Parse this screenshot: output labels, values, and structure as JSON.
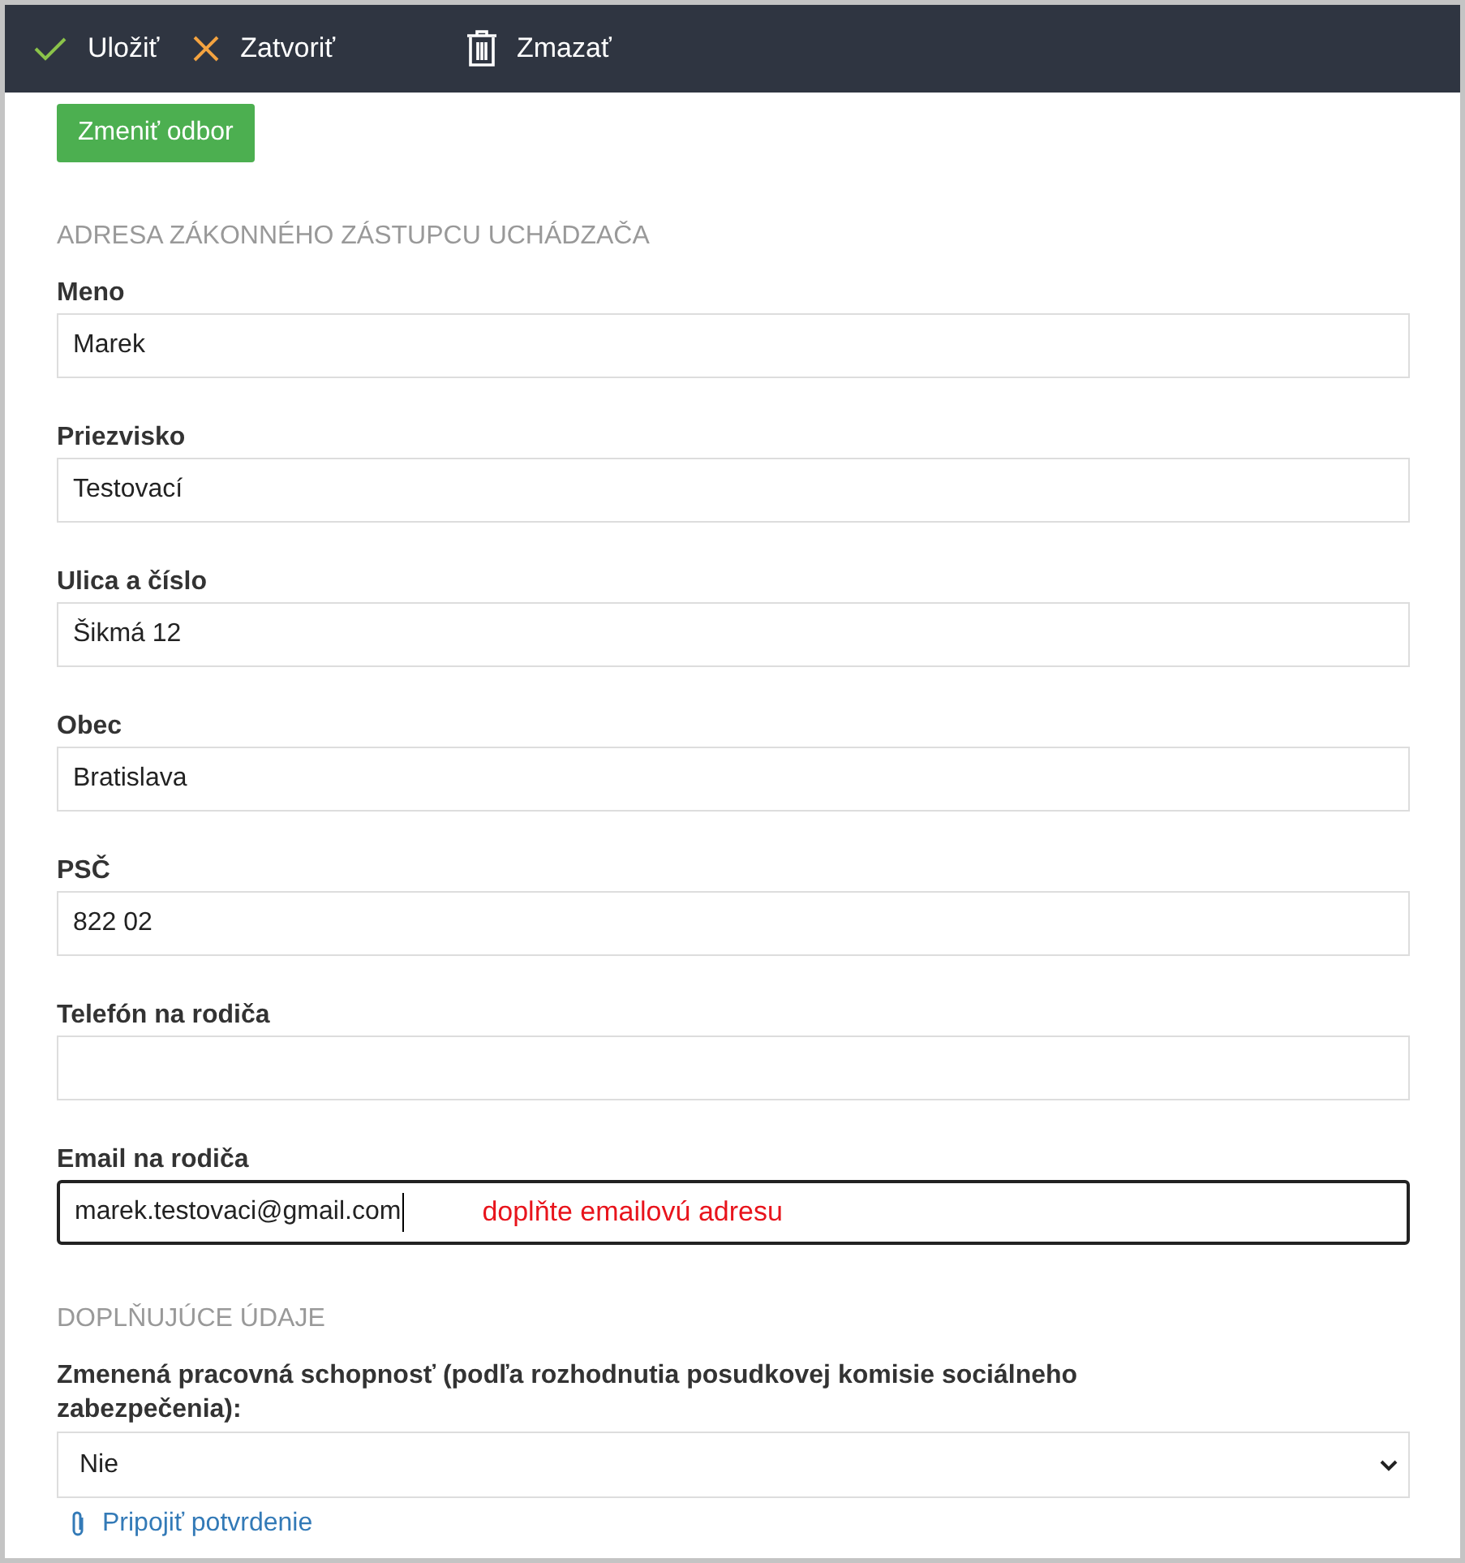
{
  "toolbar": {
    "buttons": [
      {
        "kind": "save",
        "label": "Uložiť"
      },
      {
        "kind": "close",
        "label": "Zatvoriť"
      },
      {
        "kind": "delete",
        "label": "Zmazať"
      }
    ]
  },
  "change_button": {
    "label": "Zmeniť odbor"
  },
  "sections": [
    {
      "heading": "ADRESA ZÁKONNÉHO ZÁSTUPCU UCHÁDZAČA",
      "fields": [
        {
          "kind": "text",
          "label": "Meno",
          "value": "Marek",
          "focused": false
        },
        {
          "kind": "text",
          "label": "Priezvisko",
          "value": "Testovací",
          "focused": false
        },
        {
          "kind": "text",
          "label": "Ulica a číslo",
          "value": "Šikmá 12",
          "focused": false
        },
        {
          "kind": "text",
          "label": "Obec",
          "value": "Bratislava",
          "focused": false
        },
        {
          "kind": "text",
          "label": "PSČ",
          "value": "822 02",
          "focused": false
        },
        {
          "kind": "text",
          "label": "Telefón na rodiča",
          "focused": false
        },
        {
          "kind": "text",
          "label": "Email na rodiča",
          "value": "marek.testovaci@gmail.com",
          "focused": true,
          "error": "doplňte emailovú adresu"
        }
      ]
    },
    {
      "heading": "DOPLŇUJÚCE ÚDAJE",
      "fields": [
        {
          "kind": "select",
          "label": "Zmenená pracovná schopnosť (podľa rozhodnutia posudkovej komisie sociálneho zabezpečenia):",
          "value": "Nie"
        },
        {
          "kind": "link",
          "label": "Pripojiť potvrdenie"
        }
      ]
    }
  ]
}
